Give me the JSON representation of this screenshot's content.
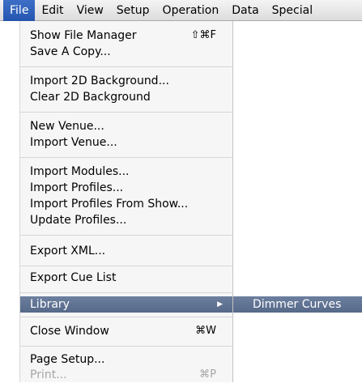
{
  "menubar": {
    "items": [
      "File",
      "Edit",
      "View",
      "Setup",
      "Operation",
      "Data",
      "Special"
    ]
  },
  "file_menu": {
    "show_file_manager": "Show File Manager",
    "show_file_manager_shortcut": "⇧⌘F",
    "save_a_copy": "Save A Copy...",
    "import_2d_background": "Import 2D Background...",
    "clear_2d_background": "Clear 2D Background",
    "new_venue": "New Venue...",
    "import_venue": "Import Venue...",
    "import_modules": "Import Modules...",
    "import_profiles": "Import Profiles...",
    "import_profiles_from_show": "Import Profiles From Show...",
    "update_profiles": "Update Profiles...",
    "export_xml": "Export XML...",
    "export_cue_list": "Export Cue List",
    "library": "Library",
    "library_arrow": "▶",
    "close_window": "Close Window",
    "close_window_shortcut": "⌘W",
    "page_setup": "Page Setup...",
    "print": "Print...",
    "print_shortcut": "⌘P"
  },
  "library_submenu": {
    "dimmer_curves": "Dimmer Curves"
  }
}
